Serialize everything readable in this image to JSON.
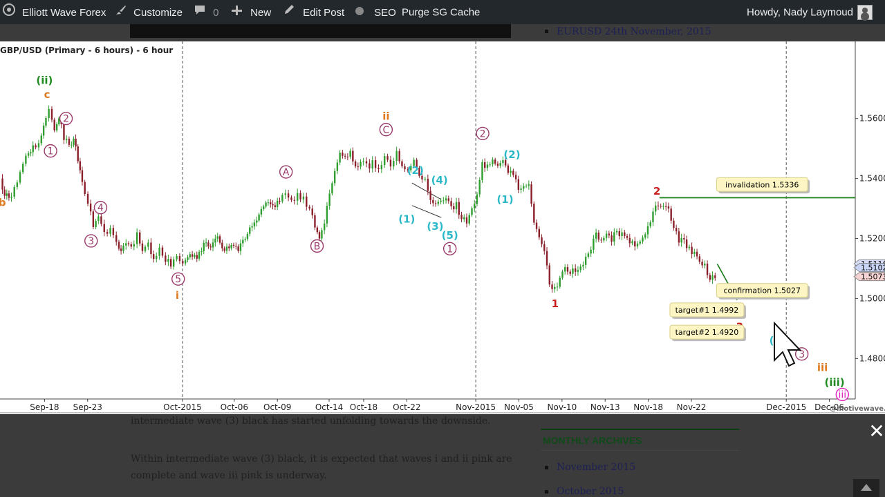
{
  "adminbar": {
    "site": "Elliott Wave Forex",
    "customize": "Customize",
    "comments": "0",
    "new": "New",
    "edit": "Edit Post",
    "seo": "SEO",
    "purge": "Purge SG Cache",
    "howdy": "Howdy, Nady Laymoud"
  },
  "page": {
    "sidebar_link_top": "EURUSD 24th November, 2015",
    "para1": "intermediate wave (3) black has started unfolding towards the downside.",
    "para2_line1": "Within intermediate wave (3) black, it is expected that waves i and ii pink are",
    "para2_line2": "complete and wave iii pink is underway.",
    "archives_title": "MONTHLY ARCHIVES",
    "archives": [
      "November 2015",
      "October 2015"
    ],
    "close_glyph": "✕"
  },
  "chart_data": {
    "type": "candlestick",
    "title": "GBP/USD (Primary - 6 hours) - 6 hour",
    "watermark": "@motivewave.com",
    "x_ticks": [
      {
        "label": "Sep-18",
        "x": 18
      },
      {
        "label": "Sep-23",
        "x": 23
      },
      {
        "label": "Oct-2015",
        "x": 34
      },
      {
        "label": "Oct-06",
        "x": 40
      },
      {
        "label": "Oct-09",
        "x": 45
      },
      {
        "label": "Oct-14",
        "x": 51
      },
      {
        "label": "Oct-18",
        "x": 55
      },
      {
        "label": "Oct-22",
        "x": 60
      },
      {
        "label": "Nov-2015",
        "x": 68
      },
      {
        "label": "Nov-05",
        "x": 73
      },
      {
        "label": "Nov-10",
        "x": 78
      },
      {
        "label": "Nov-13",
        "x": 83
      },
      {
        "label": "Nov-18",
        "x": 88
      },
      {
        "label": "Nov-22",
        "x": 93
      },
      {
        "label": "Dec-2015",
        "x": 104
      },
      {
        "label": "Dec-06",
        "x": 109
      }
    ],
    "x_range": [
      13,
      112
    ],
    "month_separators": [
      34,
      68,
      104
    ],
    "y_ticks": [
      1.48,
      1.5,
      1.52,
      1.54,
      1.56
    ],
    "y_tick_labels": [
      "1.48000",
      "1.50000",
      "1.52000",
      "1.54000",
      "1.56000"
    ],
    "ylim": [
      1.4665,
      1.5857
    ],
    "price_tags": [
      {
        "label": "1.51165",
        "value": 1.5116,
        "color": "#d6dcf5"
      },
      {
        "label": "1.51027",
        "value": 1.5103,
        "color": "#c9d3f3"
      },
      {
        "label": "1.50731",
        "value": 1.5073,
        "color": "#f5d3d3"
      }
    ],
    "path": [
      [
        13,
        1.54
      ],
      [
        13.5,
        1.535
      ],
      [
        14,
        1.533
      ],
      [
        15,
        1.539
      ],
      [
        16,
        1.548
      ],
      [
        16.8,
        1.55
      ],
      [
        17.5,
        1.551
      ],
      [
        18.3,
        1.56
      ],
      [
        18.7,
        1.564
      ],
      [
        19.3,
        1.556
      ],
      [
        19.8,
        1.56
      ],
      [
        20.4,
        1.554
      ],
      [
        21,
        1.551
      ],
      [
        21.5,
        1.553
      ],
      [
        22,
        1.546
      ],
      [
        22.5,
        1.538
      ],
      [
        23.2,
        1.532
      ],
      [
        23.8,
        1.524
      ],
      [
        24.4,
        1.528
      ],
      [
        25.1,
        1.521
      ],
      [
        25.8,
        1.523
      ],
      [
        26.5,
        1.518
      ],
      [
        27,
        1.515
      ],
      [
        27.6,
        1.5195
      ],
      [
        28.2,
        1.517
      ],
      [
        28.9,
        1.521
      ],
      [
        29.5,
        1.5165
      ],
      [
        30.2,
        1.518
      ],
      [
        30.8,
        1.514
      ],
      [
        31.5,
        1.516
      ],
      [
        32.2,
        1.513
      ],
      [
        32.8,
        1.511
      ],
      [
        33.5,
        1.514
      ],
      [
        34.2,
        1.512
      ],
      [
        35,
        1.515
      ],
      [
        35.8,
        1.514
      ],
      [
        36.6,
        1.518
      ],
      [
        37.4,
        1.5165
      ],
      [
        38.2,
        1.52
      ],
      [
        39,
        1.516
      ],
      [
        39.8,
        1.518
      ],
      [
        40.6,
        1.516
      ],
      [
        41.4,
        1.52
      ],
      [
        42.2,
        1.525
      ],
      [
        43,
        1.528
      ],
      [
        43.8,
        1.532
      ],
      [
        44.6,
        1.53
      ],
      [
        45.4,
        1.533
      ],
      [
        46.1,
        1.536
      ],
      [
        46.8,
        1.533
      ],
      [
        47.5,
        1.534
      ],
      [
        48.2,
        1.533
      ],
      [
        48.9,
        1.53
      ],
      [
        49.5,
        1.524
      ],
      [
        50,
        1.52
      ],
      [
        50.6,
        1.526
      ],
      [
        51.2,
        1.534
      ],
      [
        51.8,
        1.543
      ],
      [
        52.4,
        1.549
      ],
      [
        53,
        1.547
      ],
      [
        53.6,
        1.549
      ],
      [
        54.2,
        1.544
      ],
      [
        54.8,
        1.546
      ],
      [
        55.5,
        1.544
      ],
      [
        56.2,
        1.545
      ],
      [
        56.9,
        1.544
      ],
      [
        57.6,
        1.547
      ],
      [
        58.3,
        1.545
      ],
      [
        59,
        1.548
      ],
      [
        59.6,
        1.544
      ],
      [
        60.3,
        1.543
      ],
      [
        61,
        1.546
      ],
      [
        61.6,
        1.541
      ],
      [
        62.3,
        1.54
      ],
      [
        62.9,
        1.534
      ],
      [
        63.5,
        1.531
      ],
      [
        64.1,
        1.533
      ],
      [
        64.7,
        1.534
      ],
      [
        65.3,
        1.53
      ],
      [
        65.9,
        1.531
      ],
      [
        66.5,
        1.527
      ],
      [
        67.1,
        1.526
      ],
      [
        67.7,
        1.53
      ],
      [
        68.3,
        1.535
      ],
      [
        68.9,
        1.545
      ],
      [
        69.5,
        1.544
      ],
      [
        70.1,
        1.546
      ],
      [
        70.7,
        1.544
      ],
      [
        71.3,
        1.547
      ],
      [
        71.9,
        1.542
      ],
      [
        72.5,
        1.541
      ],
      [
        73.1,
        1.537
      ],
      [
        73.7,
        1.538
      ],
      [
        74.3,
        1.537
      ],
      [
        74.9,
        1.525
      ],
      [
        75.5,
        1.52
      ],
      [
        76.1,
        1.515
      ],
      [
        76.7,
        1.505
      ],
      [
        77.3,
        1.503
      ],
      [
        77.9,
        1.507
      ],
      [
        78.5,
        1.511
      ],
      [
        79.1,
        1.508
      ],
      [
        79.7,
        1.51
      ],
      [
        80.3,
        1.511
      ],
      [
        80.9,
        1.513
      ],
      [
        81.5,
        1.517
      ],
      [
        82.1,
        1.521
      ],
      [
        82.7,
        1.519
      ],
      [
        83.3,
        1.521
      ],
      [
        83.9,
        1.52
      ],
      [
        84.5,
        1.522
      ],
      [
        85.1,
        1.521
      ],
      [
        85.7,
        1.52
      ],
      [
        86.3,
        1.519
      ],
      [
        86.9,
        1.518
      ],
      [
        87.5,
        1.52
      ],
      [
        88.1,
        1.523
      ],
      [
        88.7,
        1.528
      ],
      [
        89.3,
        1.532
      ],
      [
        89.9,
        1.53
      ],
      [
        90.5,
        1.529
      ],
      [
        91.1,
        1.524
      ],
      [
        91.7,
        1.5195
      ],
      [
        92.3,
        1.5185
      ],
      [
        92.9,
        1.517
      ],
      [
        93.5,
        1.515
      ],
      [
        94.1,
        1.512
      ],
      [
        94.7,
        1.511
      ],
      [
        95.3,
        1.506
      ],
      [
        95.9,
        1.5073
      ]
    ],
    "triangle": {
      "upper": [
        [
          60.6,
          1.5385
        ],
        [
          64,
          1.533
        ]
      ],
      "lower": [
        [
          60.6,
          1.531
        ],
        [
          64,
          1.527
        ]
      ]
    },
    "hlines": [
      {
        "y": 1.5336,
        "x_from": 89.3,
        "x_to": 112,
        "color": "#2a8a2a"
      }
    ],
    "arrow": {
      "from": [
        96,
        1.5115
      ],
      "to": [
        98.3,
        1.4995
      ],
      "color": "#1a7a1a"
    },
    "labels": [
      {
        "text": "b",
        "x": 13.1,
        "y": 1.532,
        "color": "#e07a20",
        "style": "plain"
      },
      {
        "text": "(ii)",
        "x": 18.0,
        "y": 1.5727,
        "color": "#1f8a1f",
        "style": "plain"
      },
      {
        "text": "c",
        "x": 18.3,
        "y": 1.568,
        "color": "#e07a20",
        "style": "plain"
      },
      {
        "text": "2",
        "x": 20.5,
        "y": 1.56,
        "color": "#9a3a6a",
        "style": "circle"
      },
      {
        "text": "1",
        "x": 18.7,
        "y": 1.5492,
        "color": "#9a3a6a",
        "style": "circle"
      },
      {
        "text": "4",
        "x": 24.5,
        "y": 1.5303,
        "color": "#9a3a6a",
        "style": "circle"
      },
      {
        "text": "3",
        "x": 23.4,
        "y": 1.5192,
        "color": "#9a3a6a",
        "style": "circle"
      },
      {
        "text": "5",
        "x": 33.5,
        "y": 1.5065,
        "color": "#9a3a6a",
        "style": "circle"
      },
      {
        "text": "i",
        "x": 33.4,
        "y": 1.501,
        "color": "#e07a20",
        "style": "plain"
      },
      {
        "text": "A",
        "x": 46.0,
        "y": 1.5422,
        "color": "#9a3a6a",
        "style": "circle"
      },
      {
        "text": "B",
        "x": 49.6,
        "y": 1.5175,
        "color": "#9a3a6a",
        "style": "circle"
      },
      {
        "text": "ii",
        "x": 57.6,
        "y": 1.5607,
        "color": "#e07a20",
        "style": "plain"
      },
      {
        "text": "C",
        "x": 57.6,
        "y": 1.5563,
        "color": "#9a3a6a",
        "style": "circle"
      },
      {
        "text": "(2)",
        "x": 61.0,
        "y": 1.5427,
        "color": "#2ab8c8",
        "style": "plain"
      },
      {
        "text": "(4)",
        "x": 63.8,
        "y": 1.5395,
        "color": "#2ab8c8",
        "style": "plain"
      },
      {
        "text": "(1)",
        "x": 60.0,
        "y": 1.5265,
        "color": "#2ab8c8",
        "style": "plain"
      },
      {
        "text": "(3)",
        "x": 63.3,
        "y": 1.524,
        "color": "#2ab8c8",
        "style": "plain"
      },
      {
        "text": "(5)",
        "x": 65.0,
        "y": 1.521,
        "color": "#2ab8c8",
        "style": "plain"
      },
      {
        "text": "1",
        "x": 65.0,
        "y": 1.5166,
        "color": "#9a3a6a",
        "style": "circle"
      },
      {
        "text": "2",
        "x": 68.8,
        "y": 1.555,
        "color": "#9a3a6a",
        "style": "circle"
      },
      {
        "text": "(2)",
        "x": 72.2,
        "y": 1.548,
        "color": "#2ab8c8",
        "style": "plain"
      },
      {
        "text": "(1)",
        "x": 71.4,
        "y": 1.533,
        "color": "#2ab8c8",
        "style": "plain"
      },
      {
        "text": "1",
        "x": 77.2,
        "y": 1.4982,
        "color": "#c81e1e",
        "style": "plain"
      },
      {
        "text": "2",
        "x": 89.0,
        "y": 1.5358,
        "color": "#c81e1e",
        "style": "plain"
      },
      {
        "text": "3",
        "x": 98.6,
        "y": 1.4905,
        "color": "#c81e1e",
        "style": "plain"
      },
      {
        "text": "(3)",
        "x": 103.0,
        "y": 1.486,
        "color": "#2ab8c8",
        "style": "plain"
      },
      {
        "text": "3",
        "x": 105.8,
        "y": 1.4815,
        "color": "#9a3a6a",
        "style": "circle"
      },
      {
        "text": "iii",
        "x": 108.2,
        "y": 1.477,
        "color": "#e07a20",
        "style": "plain"
      },
      {
        "text": "(iii)",
        "x": 109.6,
        "y": 1.472,
        "color": "#1f8a1f",
        "style": "plain"
      },
      {
        "text": "iii",
        "x": 110.5,
        "y": 1.468,
        "color": "#e020c0",
        "style": "circle"
      }
    ],
    "boxes": [
      {
        "text": "invalidation 1.5336",
        "x": 101.2,
        "y": 1.538
      },
      {
        "text": "confirmation 1.5027",
        "x": 101.2,
        "y": 1.5027
      },
      {
        "text": "target#1 1.4992",
        "x": 94.8,
        "y": 1.4962
      },
      {
        "text": "target#2 1.4920",
        "x": 94.8,
        "y": 1.4888
      }
    ]
  }
}
